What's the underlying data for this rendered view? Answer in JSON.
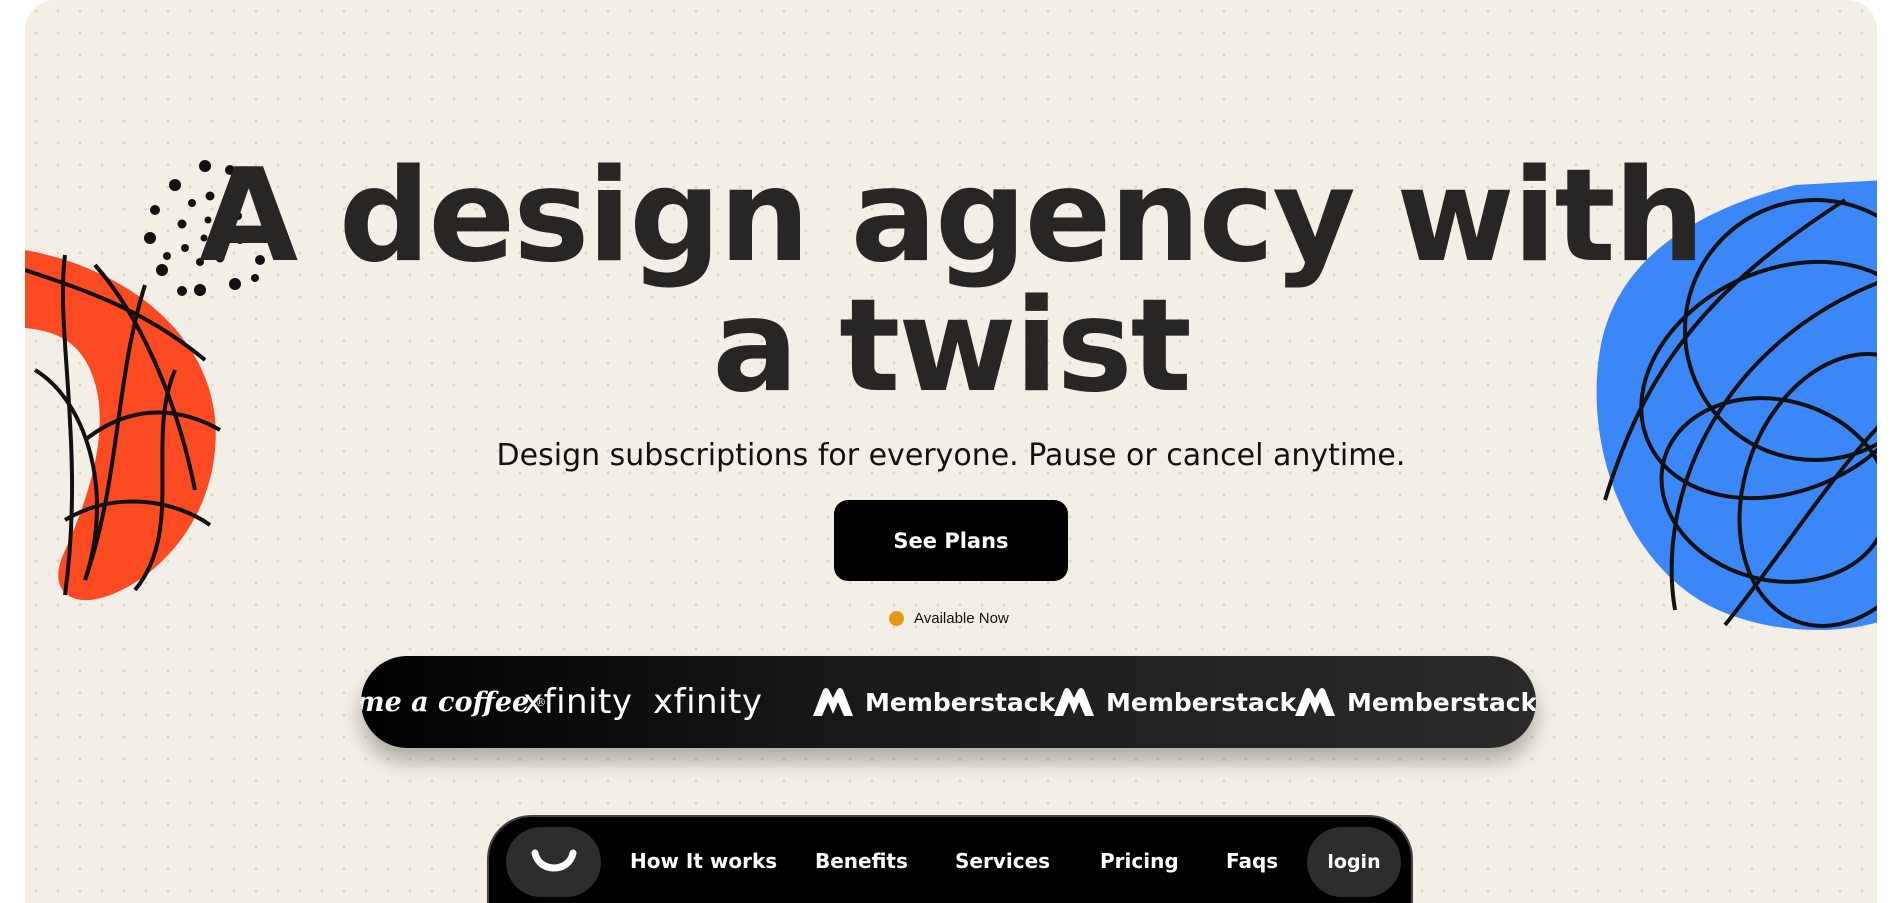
{
  "hero": {
    "headline_line1": "A design agency with",
    "headline_line2": "a twist",
    "subheadline": "Design subscriptions for everyone. Pause or cancel anytime.",
    "cta_label": "See Plans",
    "availability_text": "Available Now",
    "availability_color": "#e39a13"
  },
  "logos": {
    "items": [
      {
        "name": "me a coffee",
        "mark": "®"
      },
      {
        "name": "xfinity"
      },
      {
        "name": "xfinity"
      },
      {
        "name": "Memberstack"
      },
      {
        "name": "Memberstack"
      },
      {
        "name": "Memberstack"
      }
    ]
  },
  "nav": {
    "home_icon": "smile-logo-icon",
    "links": [
      "How It works",
      "Benefits",
      "Services",
      "Pricing",
      "Faqs"
    ],
    "login_label": "login"
  },
  "colors": {
    "background": "#f3efe7",
    "text": "#272624",
    "accent_orange": "#fc4a22",
    "accent_blue": "#3c87f8",
    "cta": "#000000"
  }
}
